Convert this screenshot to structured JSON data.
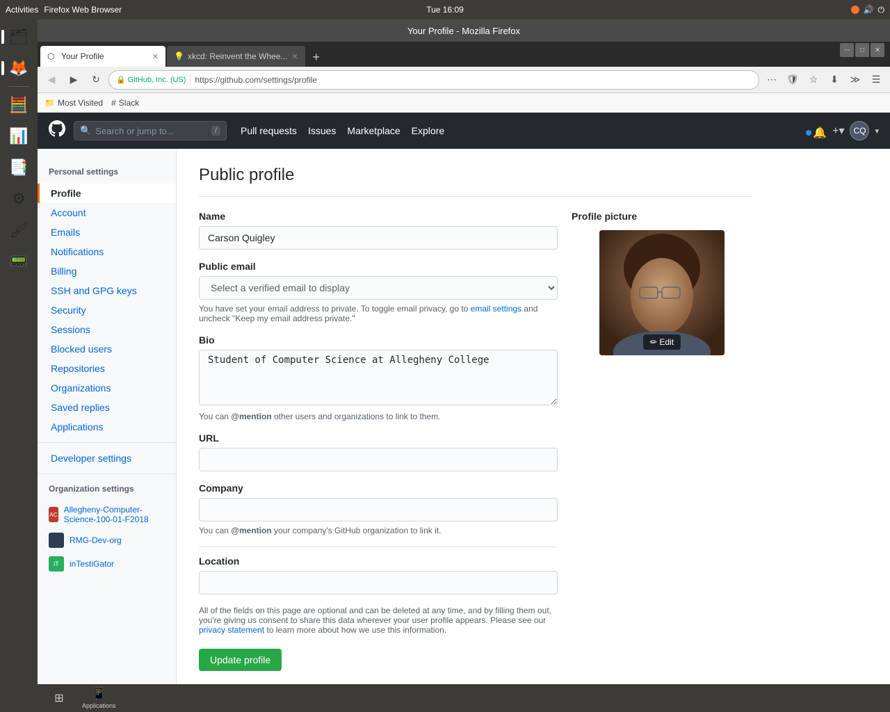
{
  "ubuntu": {
    "top_bar": {
      "activities": "Activities",
      "browser_label": "Firefox Web Browser",
      "time": "Tue 16:09"
    },
    "launcher_apps": [
      {
        "name": "files-icon",
        "icon": "🗂",
        "active": true
      },
      {
        "name": "firefox-icon",
        "icon": "🦊",
        "active": true
      },
      {
        "name": "calc-icon",
        "icon": "🧮",
        "active": false
      },
      {
        "name": "spreadsheet-icon",
        "icon": "📊",
        "active": false
      },
      {
        "name": "presentation-icon",
        "icon": "📑",
        "active": false
      },
      {
        "name": "settings-icon",
        "icon": "⚙",
        "active": false
      },
      {
        "name": "paint-icon",
        "icon": "🖌",
        "active": false
      },
      {
        "name": "terminal-icon",
        "icon": "📟",
        "active": false
      }
    ],
    "bottom_bar": {
      "apps_label": "Applications"
    }
  },
  "browser": {
    "title": "Your Profile - Mozilla Firefox",
    "tabs": [
      {
        "label": "Your Profile",
        "active": true,
        "favicon": "🔵"
      },
      {
        "label": "xkcd: Reinvent the Whee...",
        "active": false,
        "favicon": "🔵"
      }
    ],
    "address": "https://github.com/settings/profile",
    "secure_text": "GitHub, Inc. (US)",
    "bookmarks": [
      {
        "label": "Most Visited"
      },
      {
        "label": "Slack"
      }
    ]
  },
  "github": {
    "header": {
      "search_placeholder": "Search or jump to...",
      "nav_items": [
        "Pull requests",
        "Issues",
        "Marketplace",
        "Explore"
      ]
    },
    "sidebar": {
      "personal_settings_title": "Personal settings",
      "items": [
        {
          "label": "Profile",
          "active": true
        },
        {
          "label": "Account"
        },
        {
          "label": "Emails"
        },
        {
          "label": "Notifications"
        },
        {
          "label": "Billing"
        },
        {
          "label": "SSH and GPG keys"
        },
        {
          "label": "Security"
        },
        {
          "label": "Sessions"
        },
        {
          "label": "Blocked users"
        },
        {
          "label": "Repositories"
        },
        {
          "label": "Organizations"
        },
        {
          "label": "Saved replies"
        },
        {
          "label": "Applications"
        }
      ],
      "developer_settings": "Developer settings",
      "org_settings_title": "Organization settings",
      "orgs": [
        {
          "label": "Allegheny-Computer-Science-100-01-F2018",
          "color": "#c0392b"
        },
        {
          "label": "RMG-Dev-org",
          "color": "#2c3e50"
        },
        {
          "label": "inTestiGator",
          "color": "#27ae60"
        }
      ]
    },
    "profile": {
      "page_title": "Public profile",
      "name_label": "Name",
      "name_value": "Carson Quigley",
      "email_label": "Public email",
      "email_placeholder": "Select a verified email to display",
      "email_note": "You have set your email address to private. To toggle email privacy, go to",
      "email_note_link": "email settings",
      "email_note_suffix": "and uncheck \"Keep my email address private.\"",
      "bio_label": "Bio",
      "bio_value": "Student of Computer Science at Allegheny College",
      "bio_note_prefix": "You can",
      "bio_note_mention": "@mention",
      "bio_note_suffix": "other users and organizations to link to them.",
      "url_label": "URL",
      "url_value": "",
      "company_label": "Company",
      "company_value": "",
      "company_note_prefix": "You can",
      "company_note_mention": "@mention",
      "company_note_suffix": "your company's GitHub organization to link it.",
      "location_label": "Location",
      "location_value": "",
      "consent_note": "All of the fields on this page are optional and can be deleted at any time, and by filling them out, you're giving us consent to share this data wherever your user profile appears. Please see our",
      "consent_link": "privacy statement",
      "consent_suffix": "to learn more about how we use this information.",
      "update_btn": "Update profile",
      "picture_title": "Profile picture",
      "picture_edit_btn": "✏ Edit"
    }
  }
}
